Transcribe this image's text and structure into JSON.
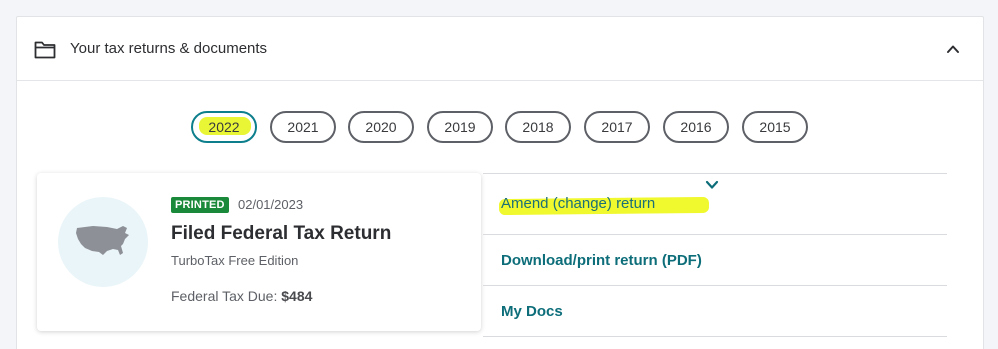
{
  "panel": {
    "title": "Your tax returns & documents",
    "icons": {
      "folder": "folder-icon",
      "collapse": "chevron-up-icon"
    }
  },
  "years": [
    {
      "label": "2022",
      "selected": true
    },
    {
      "label": "2021",
      "selected": false
    },
    {
      "label": "2020",
      "selected": false
    },
    {
      "label": "2019",
      "selected": false
    },
    {
      "label": "2018",
      "selected": false
    },
    {
      "label": "2017",
      "selected": false
    },
    {
      "label": "2016",
      "selected": false
    },
    {
      "label": "2015",
      "selected": false
    }
  ],
  "return_card": {
    "badge": "PRINTED",
    "date": "02/01/2023",
    "title": "Filed Federal Tax Return",
    "edition": "TurboTax Free Edition",
    "tax_due_label": "Federal Tax Due:",
    "tax_due_amount": "$484",
    "map_icon": "us-map-icon"
  },
  "actions": {
    "amend": "Amend (change) return",
    "download": "Download/print return (PDF)",
    "my_docs": "My Docs"
  },
  "colors": {
    "accent": "#0d6e7a",
    "badge_green": "#1a8a3a",
    "highlight": "#f0f82e"
  }
}
